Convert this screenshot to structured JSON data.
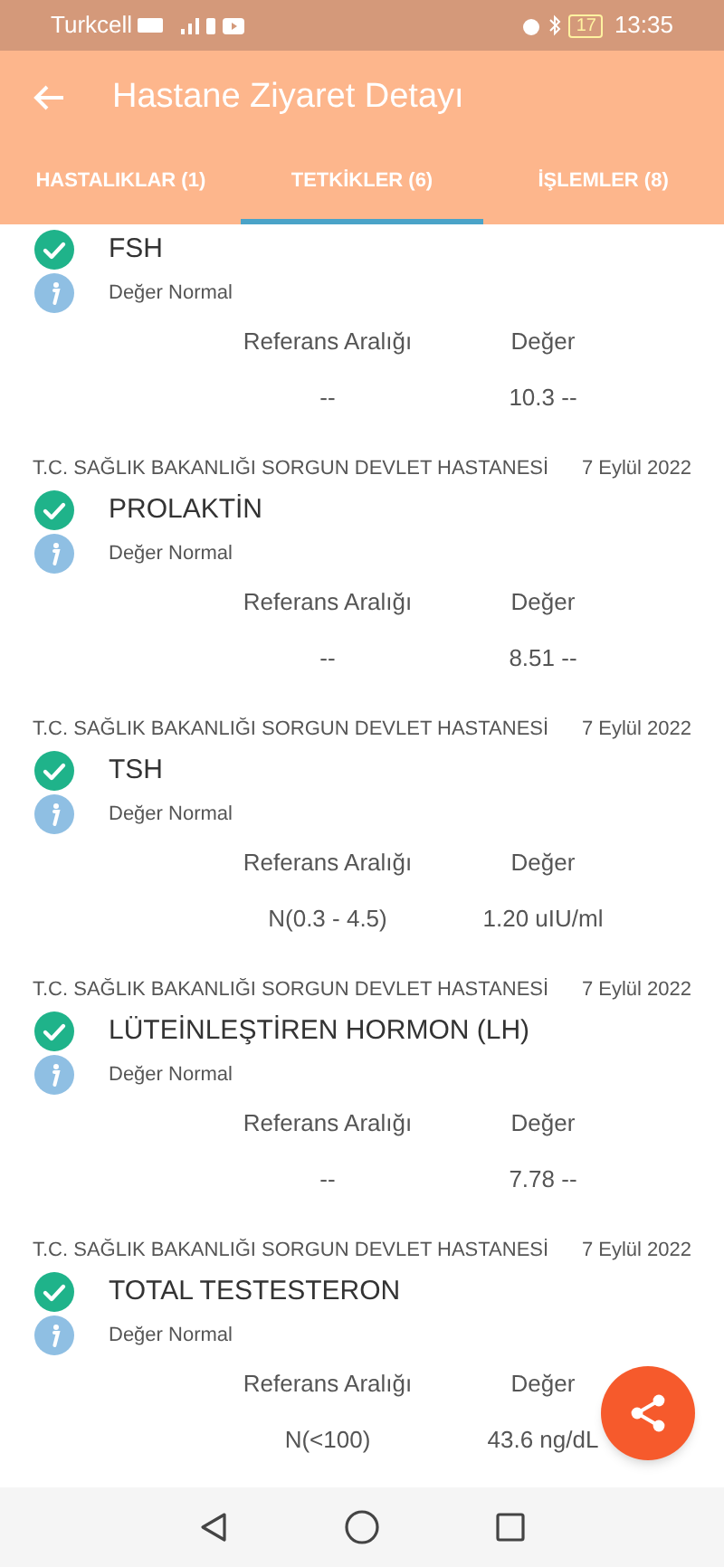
{
  "status_bar": {
    "carrier": "Turkcell",
    "battery": "17",
    "time": "13:35"
  },
  "app_bar": {
    "title": "Hastane Ziyaret Detayı"
  },
  "tabs": [
    {
      "label": "HASTALIKLAR (1)",
      "selected": false
    },
    {
      "label": "TETKİKLER (6)",
      "selected": true
    },
    {
      "label": "İŞLEMLER (8)",
      "selected": false
    }
  ],
  "tests": [
    {
      "name": "FSH",
      "status": "Değer Normal",
      "range_label": "Referans Aralığı",
      "value_label": "Değer",
      "range": "--",
      "value": "10.3 --"
    },
    {
      "hospital": "T.C. SAĞLIK BAKANLIĞI SORGUN DEVLET HASTANESİ",
      "date": "7 Eylül 2022",
      "name": "PROLAKTİN",
      "status": "Değer Normal",
      "range_label": "Referans Aralığı",
      "value_label": "Değer",
      "range": "--",
      "value": "8.51 --"
    },
    {
      "hospital": "T.C. SAĞLIK BAKANLIĞI SORGUN DEVLET HASTANESİ",
      "date": "7 Eylül 2022",
      "name": "TSH",
      "status": "Değer Normal",
      "range_label": "Referans Aralığı",
      "value_label": "Değer",
      "range": "N(0.3 - 4.5)",
      "value": "1.20 uIU/ml"
    },
    {
      "hospital": "T.C. SAĞLIK BAKANLIĞI SORGUN DEVLET HASTANESİ",
      "date": "7 Eylül 2022",
      "name": "LÜTEİNLEŞTİREN HORMON (LH)",
      "status": "Değer Normal",
      "range_label": "Referans Aralığı",
      "value_label": "Değer",
      "range": "--",
      "value": "7.78 --"
    },
    {
      "hospital": "T.C. SAĞLIK BAKANLIĞI SORGUN DEVLET HASTANESİ",
      "date": "7 Eylül 2022",
      "name": "TOTAL TESTESTERON",
      "status": "Değer Normal",
      "range_label": "Referans Aralığı",
      "value_label": "Değer",
      "range": "N(<100)",
      "value": "43.6 ng/dL"
    }
  ]
}
